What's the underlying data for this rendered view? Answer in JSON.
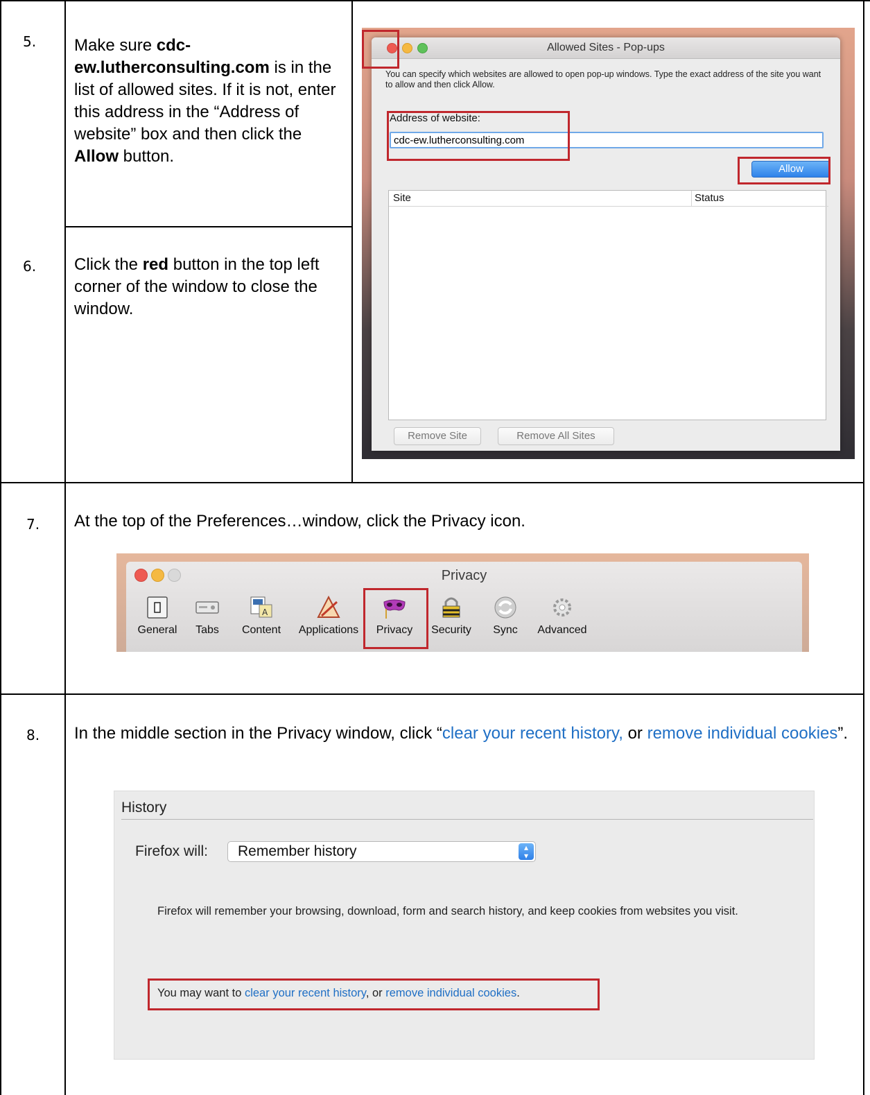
{
  "steps": [
    {
      "number": "5.",
      "text_parts": [
        "Make sure ",
        "cdc-ew.lutherconsulting.com",
        " is in the list of allowed sites. If it is not, enter this address in the “Address of website” box and then click the ",
        "Allow",
        " button."
      ]
    },
    {
      "number": "6.",
      "text_parts": [
        "Click the ",
        "red",
        " button in the top left corner of the window to close the window."
      ]
    },
    {
      "number": "7.",
      "text": "At the top of the Preferences…window, click the Privacy icon."
    },
    {
      "number": "8.",
      "text_parts": [
        "In the middle section in the Privacy window, click “",
        "clear your recent history,",
        " or ",
        "remove individual cookies",
        "”."
      ]
    }
  ],
  "allowed_sites_window": {
    "title": "Allowed Sites - Pop-ups",
    "description": "You can specify which websites are allowed to open pop-up windows. Type the exact address of the site you want to allow and then click Allow.",
    "address_label": "Address of website:",
    "address_value": "cdc-ew.lutherconsulting.com",
    "allow_button": "Allow",
    "columns": [
      "Site",
      "Status"
    ],
    "remove_site_button": "Remove Site",
    "remove_all_button": "Remove All Sites",
    "traffic_lights": {
      "close": "#ee5a52",
      "minimize": "#f5b942",
      "zoom": "#5fc15a"
    }
  },
  "privacy_window": {
    "title": "Privacy",
    "toolbar": [
      {
        "label": "General",
        "icon": "switch-icon"
      },
      {
        "label": "Tabs",
        "icon": "tabs-icon"
      },
      {
        "label": "Content",
        "icon": "content-icon"
      },
      {
        "label": "Applications",
        "icon": "applications-icon"
      },
      {
        "label": "Privacy",
        "icon": "mask-icon"
      },
      {
        "label": "Security",
        "icon": "padlock-icon"
      },
      {
        "label": "Sync",
        "icon": "sync-icon"
      },
      {
        "label": "Advanced",
        "icon": "gear-icon"
      }
    ]
  },
  "history_panel": {
    "heading": "History",
    "firefox_will_label": "Firefox will:",
    "firefox_will_value": "Remember history",
    "description": "Firefox will remember your browsing, download, form and search history, and keep cookies from websites you visit.",
    "links_prefix": "You may want to ",
    "link_clear": "clear your recent history",
    "links_middle": ", or ",
    "link_remove": "remove individual cookies",
    "links_suffix": "."
  },
  "colors": {
    "annotation_red": "#c0272d",
    "link_blue": "#1f6fc5",
    "button_blue": "#2f83ea"
  }
}
